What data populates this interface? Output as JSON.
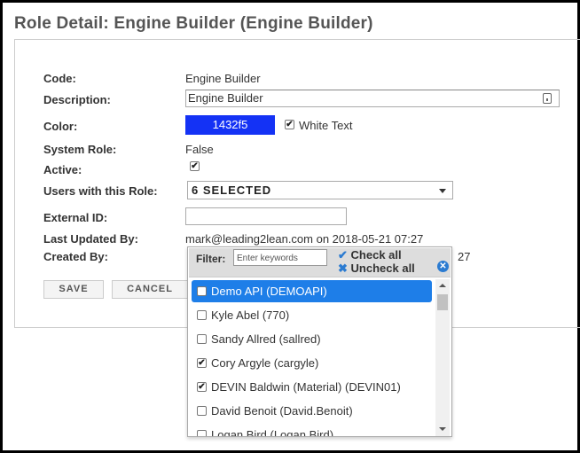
{
  "page_title": "Role Detail: Engine Builder (Engine Builder)",
  "form": {
    "code_label": "Code:",
    "code_value": "Engine Builder",
    "description_label": "Description:",
    "description_value": "Engine Builder",
    "color_label": "Color:",
    "color_value": "1432f5",
    "color_hex": "#1432f5",
    "white_text_label": "White Text",
    "white_text_checked": true,
    "system_role_label": "System Role:",
    "system_role_value": "False",
    "active_label": "Active:",
    "active_checked": true,
    "users_label": "Users with this Role:",
    "users_value": "6 SELECTED",
    "external_id_label": "External ID:",
    "external_id_value": "",
    "last_updated_label": "Last Updated By:",
    "last_updated_value": "mark@leading2lean.com on 2018-05-21 07:27",
    "created_label": "Created By:",
    "created_value_tail": "27"
  },
  "buttons": {
    "save": "SAVE",
    "cancel": "CANCEL"
  },
  "dropdown": {
    "filter_label": "Filter:",
    "filter_placeholder": "Enter keywords",
    "check_all": "Check all",
    "uncheck_all": "Uncheck all",
    "items": [
      {
        "label": "Demo API (DEMOAPI)",
        "checked": false,
        "highlighted": true
      },
      {
        "label": "Kyle Abel (770)",
        "checked": false,
        "highlighted": false
      },
      {
        "label": "Sandy Allred (sallred)",
        "checked": false,
        "highlighted": false
      },
      {
        "label": "Cory Argyle (cargyle)",
        "checked": true,
        "highlighted": false
      },
      {
        "label": "DEVIN Baldwin (Material) (DEVIN01)",
        "checked": true,
        "highlighted": false
      },
      {
        "label": "David Benoit (David.Benoit)",
        "checked": false,
        "highlighted": false
      },
      {
        "label": "Logan Bird (Logan.Bird)",
        "checked": false,
        "highlighted": false
      }
    ]
  },
  "icons": {
    "check": "✔",
    "cross": "✖",
    "close": "✕"
  },
  "colors": {
    "accent": "#1e7ee8",
    "link_blue": "#2b7bd1"
  }
}
